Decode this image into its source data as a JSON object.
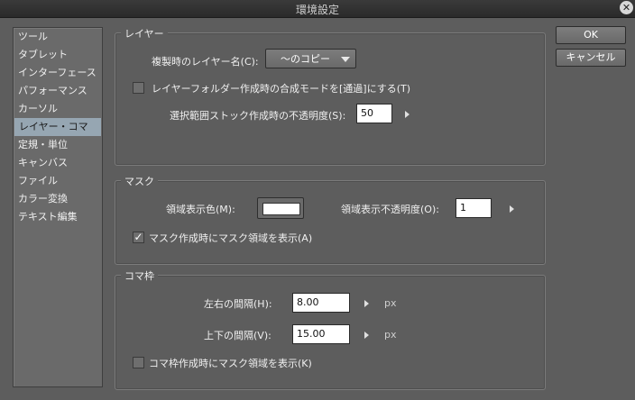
{
  "window": {
    "title": "環境設定",
    "close": "✕"
  },
  "sidebar": {
    "items": [
      {
        "label": "ツール"
      },
      {
        "label": "タブレット"
      },
      {
        "label": "インターフェース"
      },
      {
        "label": "パフォーマンス"
      },
      {
        "label": "カーソル"
      },
      {
        "label": "レイヤー・コマ",
        "active": true
      },
      {
        "label": "定規・単位"
      },
      {
        "label": "キャンバス"
      },
      {
        "label": "ファイル"
      },
      {
        "label": "カラー変換"
      },
      {
        "label": "テキスト編集"
      }
    ]
  },
  "buttons": {
    "ok": "OK",
    "cancel": "キャンセル"
  },
  "layer": {
    "title": "レイヤー",
    "copy_name_label": "複製時のレイヤー名(C):",
    "copy_name_value": "〜のコピー",
    "folder_mode_label": "レイヤーフォルダー作成時の合成モードを[通過]にする(T)",
    "folder_mode_checked": false,
    "stock_opacity_label": "選択範囲ストック作成時の不透明度(S):",
    "stock_opacity_value": "50"
  },
  "mask": {
    "title": "マスク",
    "area_color_label": "領域表示色(M):",
    "area_color": "#ffffff",
    "area_opacity_label": "領域表示不透明度(O):",
    "area_opacity_value": "1",
    "show_on_create_label": "マスク作成時にマスク領域を表示(A)",
    "show_on_create_checked": true,
    "check_mark": "✓"
  },
  "frame": {
    "title": "コマ枠",
    "h_gap_label": "左右の間隔(H):",
    "h_gap_value": "8.00",
    "v_gap_label": "上下の間隔(V):",
    "v_gap_value": "15.00",
    "unit": "px",
    "show_mask_label": "コマ枠作成時にマスク領域を表示(K)",
    "show_mask_checked": false
  }
}
